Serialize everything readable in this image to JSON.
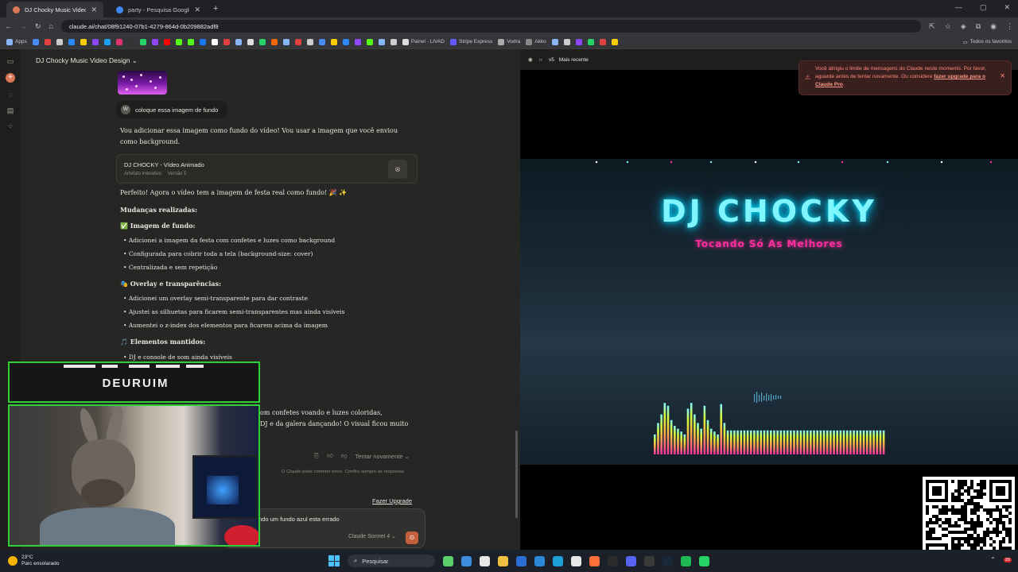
{
  "browser": {
    "tabs": [
      {
        "title": "DJ Chocky Music Video Design",
        "active": true,
        "color": "#d97757"
      },
      {
        "title": "party - Pesquisa Google",
        "active": false,
        "color": "#4285f4"
      }
    ],
    "url": "claude.ai/chat/08f91240-07b1-4279-864d-0b209882adf8",
    "bookmarks_apps": "Apps",
    "bookmarks_named": [
      "Painel - LIVAD",
      "Stripe Express",
      "Vodra",
      "Akko"
    ],
    "bookmarks_all": "Todos os favoritos"
  },
  "chat": {
    "title": "DJ Chocky Music Video Design",
    "user_initial": "W",
    "user_message": "coloque essa imagem de fundo",
    "reply_intro": "Vou adicionar essa imagem como fundo do vídeo! Vou usar a imagem que você enviou como background.",
    "artifact": {
      "title": "DJ CHOCKY - Vídeo Animado",
      "kind": "Artefato interativo",
      "version": "Versão 5"
    },
    "reply_done": "Perfeito! Agora o vídeo tem a imagem de festa real como fundo! 🎉 ✨",
    "changes_heading": "Mudanças realizadas:",
    "section1": {
      "heading": "✅ Imagem de fundo:",
      "items": [
        "Adicionei a imagem da festa com confetes e luzes como background",
        "Configurada para cobrir toda a tela (background-size: cover)",
        "Centralizada e sem repetição"
      ]
    },
    "section2": {
      "heading": "🎭 Overlay e transparências:",
      "items": [
        "Adicionei um overlay semi-transparente para dar contraste",
        "Ajustei as silhuetas para ficarem semi-transparentes mas ainda visíveis",
        "Aumentei o z-index dos elementos para ficarem acima da imagem"
      ]
    },
    "section3": {
      "heading": "🎵 Elementos mantidos:",
      "items": [
        "DJ e console de som ainda visíveis"
      ]
    },
    "partial_line1": "om confetes voando e luzes coloridas,",
    "partial_line2": "DJ e da galera dançando! O visual ficou muito",
    "retry_label": "Tentar novamente",
    "disclaimer": "O Claude pode cometer erros. Confira sempre as respostas.",
    "upgrade_label": "Fazer Upgrade",
    "input_value": "ndo um fundo azul esta errado",
    "model_label": "Claude Sonnet 4"
  },
  "webcam": {
    "name": "DEURUIM"
  },
  "preview": {
    "version_label": "v5",
    "version_desc": "Mais recente",
    "title": "DJ CHOCKY",
    "subtitle": "Tocando Só As Melhores",
    "accent_cyan": "#7ff6ff",
    "accent_pink": "#ff2fa0",
    "visualizer_levels": [
      0.35,
      0.55,
      0.7,
      0.9,
      0.85,
      0.6,
      0.5,
      0.45,
      0.4,
      0.35,
      0.8,
      0.9,
      0.7,
      0.55,
      0.45,
      0.85,
      0.6,
      0.45,
      0.4,
      0.35,
      0.88,
      0.55,
      0.42,
      0.42,
      0.42,
      0.42,
      0.42,
      0.42,
      0.42,
      0.42,
      0.42,
      0.42,
      0.42,
      0.42,
      0.42,
      0.42,
      0.42,
      0.42,
      0.42,
      0.42,
      0.42,
      0.42,
      0.42,
      0.42,
      0.42,
      0.42,
      0.42,
      0.42,
      0.42,
      0.42,
      0.42,
      0.42,
      0.42,
      0.42,
      0.42,
      0.42,
      0.42,
      0.42,
      0.42,
      0.42,
      0.42,
      0.42,
      0.42,
      0.42,
      0.42,
      0.42,
      0.42,
      0.42,
      0.42,
      0.42
    ]
  },
  "toast": {
    "message": "Você atingiu o limite de mensagens do Claude neste momento. Por favor, aguarde antes de tentar novamente. Ou considere",
    "link": "fazer upgrade para o Claude Pro",
    "end": "."
  },
  "taskbar": {
    "temperature": "23°C",
    "weather": "Parc ensolarado",
    "search_label": "Pesquisar",
    "notifications": "20"
  }
}
